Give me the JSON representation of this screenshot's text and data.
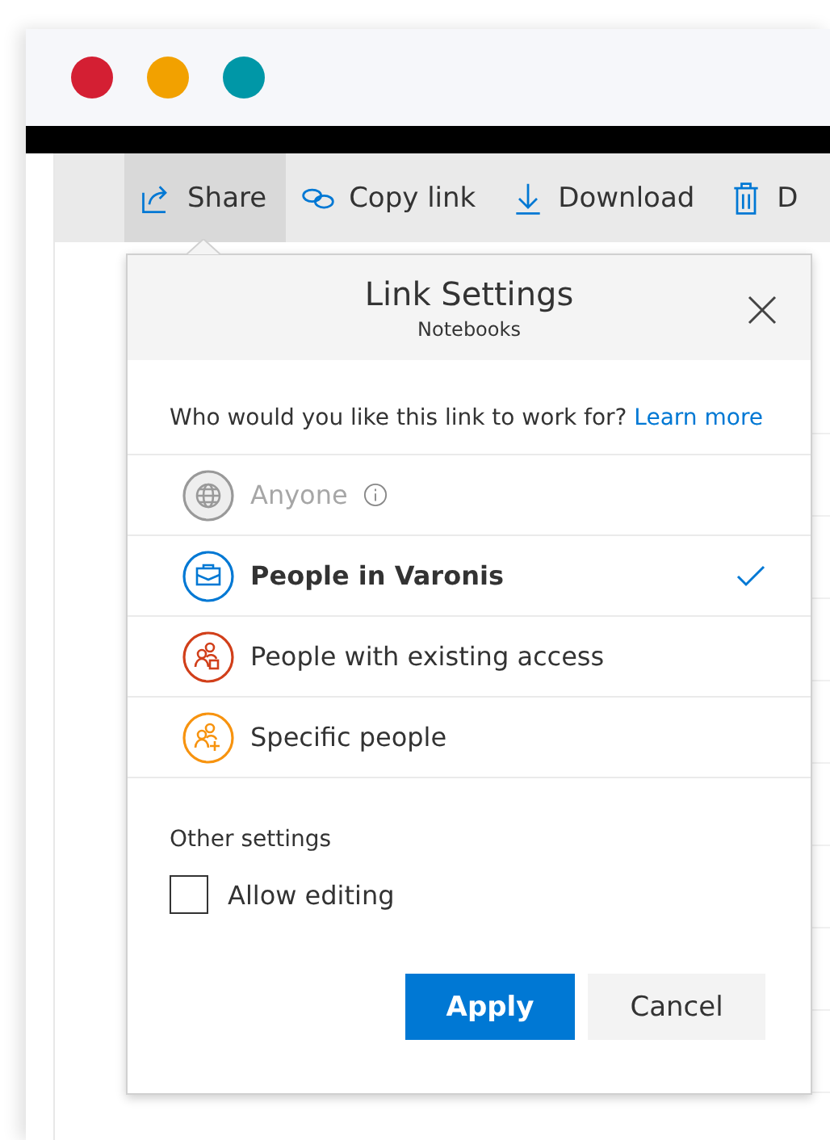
{
  "window": {
    "controls": [
      {
        "color": "#d41f33"
      },
      {
        "color": "#f2a100"
      },
      {
        "color": "#0097a7"
      }
    ]
  },
  "toolbar": {
    "items": [
      {
        "kind": "share",
        "label": "Share",
        "selected": true
      },
      {
        "kind": "copy",
        "label": "Copy link",
        "selected": false
      },
      {
        "kind": "download",
        "label": "Download",
        "selected": false
      },
      {
        "kind": "delete",
        "label": "D",
        "selected": false
      }
    ]
  },
  "dialog": {
    "title": "Link Settings",
    "subtitle": "Notebooks",
    "question": "Who would you like this link to work for?",
    "learn_more": "Learn more",
    "options": [
      {
        "kind": "anyone",
        "label": "Anyone",
        "disabled": true,
        "selected": false,
        "info": true
      },
      {
        "kind": "organization",
        "label": "People in Varonis",
        "disabled": false,
        "selected": true,
        "info": false
      },
      {
        "kind": "existing",
        "label": "People with existing access",
        "disabled": false,
        "selected": false,
        "info": false
      },
      {
        "kind": "specific",
        "label": "Specific people",
        "disabled": false,
        "selected": false,
        "info": false
      }
    ],
    "other_settings": "Other settings",
    "allow_editing": {
      "label": "Allow editing",
      "checked": false
    },
    "buttons": [
      {
        "kind": "primary",
        "label": "Apply"
      },
      {
        "kind": "secondary",
        "label": "Cancel"
      }
    ]
  }
}
